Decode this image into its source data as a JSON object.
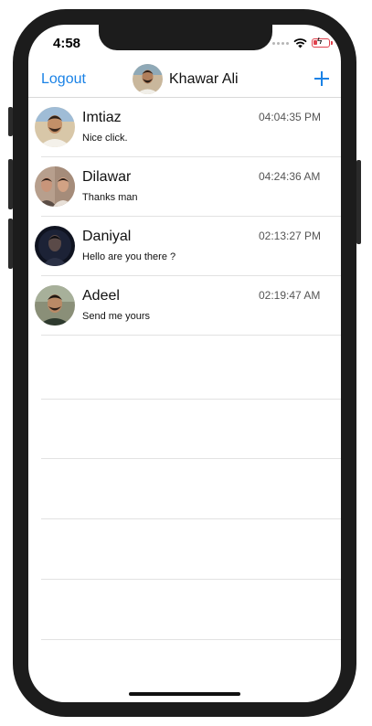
{
  "status_bar": {
    "time": "4:58"
  },
  "navbar": {
    "left_button": "Logout",
    "title": "Khawar Ali",
    "right_icon": "plus-icon",
    "accent_color": "#1a82e6"
  },
  "conversations": [
    {
      "name": "Imtiaz",
      "message": "Nice click.",
      "time": "04:04:35 PM"
    },
    {
      "name": "Dilawar",
      "message": "Thanks man",
      "time": "04:24:36 AM"
    },
    {
      "name": "Daniyal",
      "message": "Hello are you there ?",
      "time": "02:13:27 PM"
    },
    {
      "name": "Adeel",
      "message": "Send me yours",
      "time": "02:19:47 AM"
    }
  ]
}
